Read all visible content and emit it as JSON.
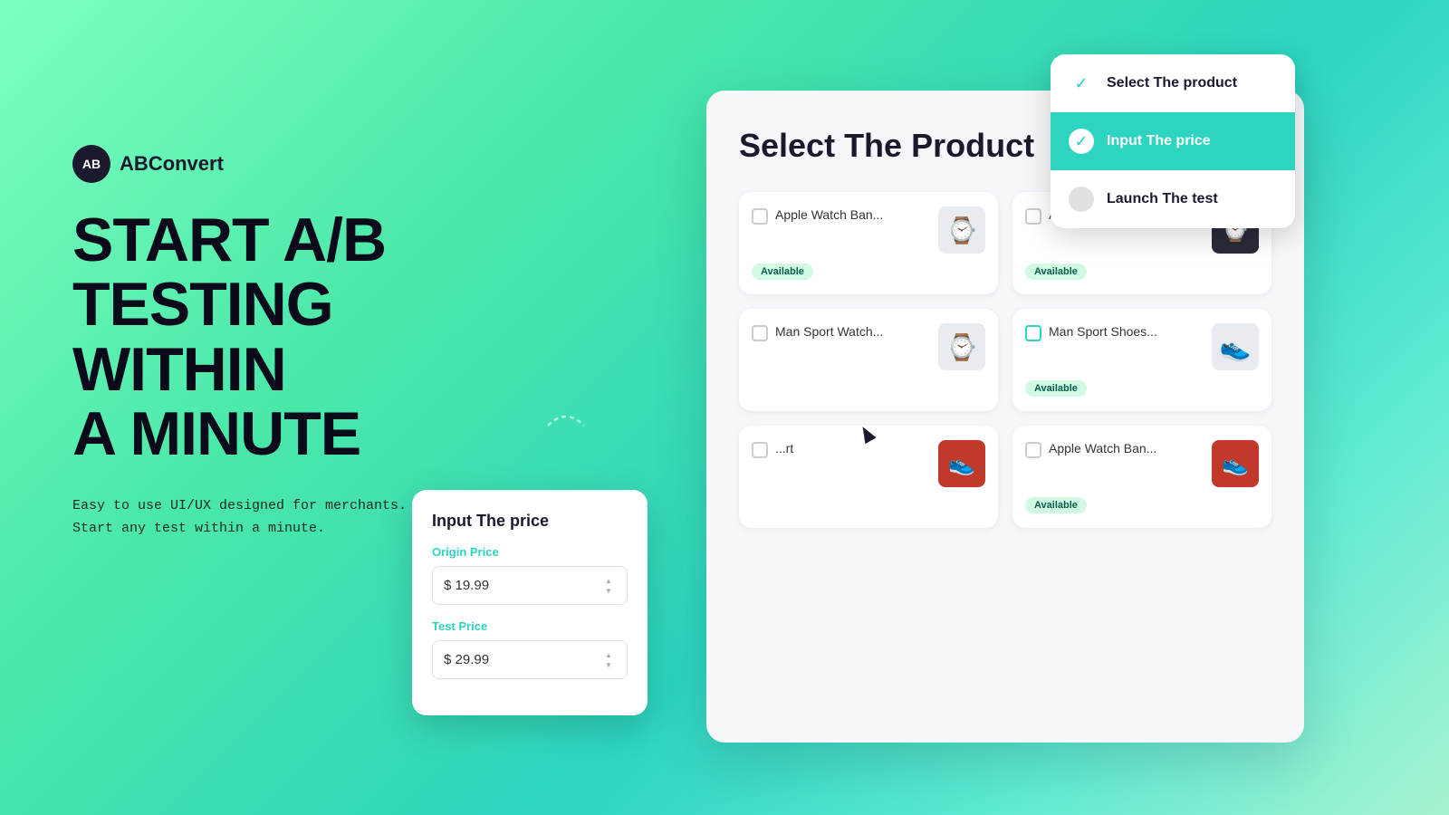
{
  "brand": {
    "icon": "AB",
    "name": "ABConvert"
  },
  "headline": {
    "line1": "START A/B",
    "line2": "TESTING",
    "line3": "WITHIN",
    "line4": "A MINUTE"
  },
  "subtitle": {
    "line1": "Easy to use UI/UX designed for merchants.",
    "line2": "Start any test within a minute."
  },
  "main_card": {
    "title": "Select The  Product"
  },
  "products": [
    {
      "name": "Apple Watch Ban...",
      "status": "Available",
      "emoji": "⌚"
    },
    {
      "name": "Apple Watch Ban...",
      "status": "Available",
      "emoji": "⌚"
    },
    {
      "name": "Man Sport Watch...",
      "status": "",
      "emoji": "⌚"
    },
    {
      "name": "Man Sport Shoes...",
      "status": "Available",
      "emoji": "👟"
    },
    {
      "name": "...rt",
      "status": "",
      "emoji": "👟"
    },
    {
      "name": "Apple Watch Ban...",
      "status": "Available",
      "emoji": "👟"
    }
  ],
  "stepper": {
    "steps": [
      {
        "label": "Select The product",
        "state": "done"
      },
      {
        "label": "Input The price",
        "state": "active"
      },
      {
        "label": "Launch The test",
        "state": "pending"
      }
    ]
  },
  "price_card": {
    "title": "Input The price",
    "origin_label": "Origin Price",
    "origin_value": "$ 19.99",
    "test_label": "Test Price",
    "test_value": "$ 29.99"
  },
  "colors": {
    "teal": "#2dd4bf",
    "dark": "#1a1a2e",
    "green_badge": "#d1fae5"
  }
}
